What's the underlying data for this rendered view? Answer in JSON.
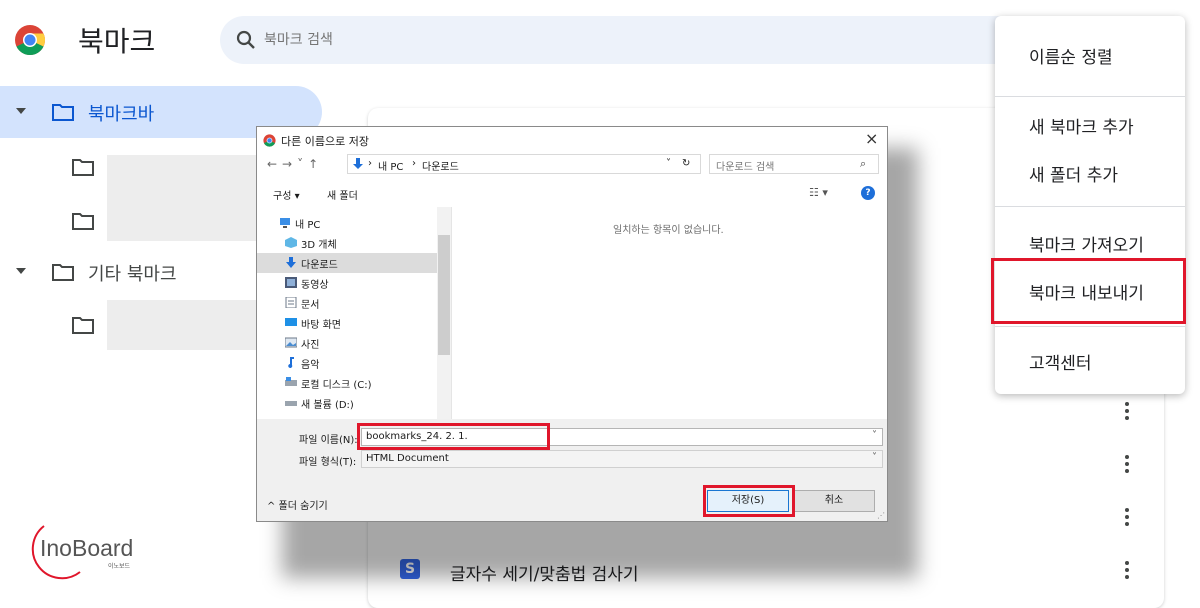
{
  "app": {
    "title": "북마크"
  },
  "search": {
    "placeholder": "북마크 검색"
  },
  "sidebar": {
    "bookmark_bar": "북마크바",
    "other_bookmarks": "기타 북마크"
  },
  "rows": [
    {
      "label": "글자수 세기/맞춤법 검사기",
      "icon_text": "S",
      "icon_color": "#3366e6"
    }
  ],
  "menu": {
    "items": [
      "이름순 정렬",
      "새 북마크 추가",
      "새 폴더 추가",
      "북마크 가져오기",
      "북마크 내보내기",
      "고객센터"
    ],
    "highlighted": "북마크 내보내기",
    "highlight_color": "#e0162b"
  },
  "dialog": {
    "title": "다른 이름으로 저장",
    "path": [
      "내 PC",
      "다운로드"
    ],
    "search_placeholder": "다운로드 검색",
    "organize": "구성 ▾",
    "new_folder": "새 폴더",
    "tree": [
      "내 PC",
      "3D 개체",
      "다운로드",
      "동영상",
      "문서",
      "바탕 화면",
      "사진",
      "음악",
      "로컬 디스크 (C:)",
      "새 볼륨 (D:)"
    ],
    "selected": "다운로드",
    "empty_message": "일치하는 항목이 없습니다.",
    "filename_label": "파일 이름(N):",
    "filename_value": "bookmarks_24. 2. 1.",
    "filetype_label": "파일 형식(T):",
    "filetype_value": "HTML Document",
    "hide_folders": "^ 폴더 숨기기",
    "save_button": "저장(S)",
    "cancel_button": "취소"
  },
  "watermark": {
    "brand": "InoBoard",
    "sub": "이노보드"
  },
  "colors": {
    "accent": "#0b57d0",
    "selection": "#d3e3fd"
  }
}
